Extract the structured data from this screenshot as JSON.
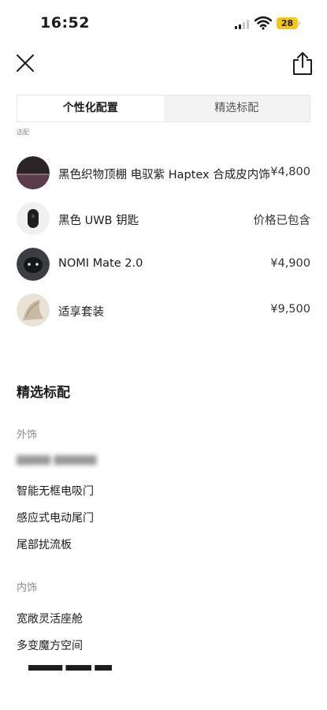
{
  "status_bar": {
    "time": "16:52",
    "battery": "28"
  },
  "tabs": [
    {
      "label": "个性化配置"
    },
    {
      "label": "精选标配"
    }
  ],
  "partial_label": "选配",
  "options": [
    {
      "name": "黑色织物顶棚 电驭紫 Haptex 合成皮内饰",
      "price": "¥4,800",
      "icon": "interior-trim-thumbnail"
    },
    {
      "name": "黑色 UWB 钥匙",
      "price": "价格已包含",
      "icon": "key-fob-thumbnail"
    },
    {
      "name": "NOMI Mate 2.0",
      "price": "¥4,900",
      "icon": "nomi-mate-thumbnail"
    },
    {
      "name": "适享套装",
      "price": "¥9,500",
      "icon": "comfort-package-thumbnail"
    }
  ],
  "standard": {
    "title": "精选标配",
    "exterior": {
      "label": "外饰",
      "items": [
        "智能无框电吸门",
        "感应式电动尾门",
        "尾部扰流板"
      ]
    },
    "interior": {
      "label": "内饰",
      "items": [
        "宽敞灵活座舱",
        "多变魔方空间"
      ]
    }
  }
}
